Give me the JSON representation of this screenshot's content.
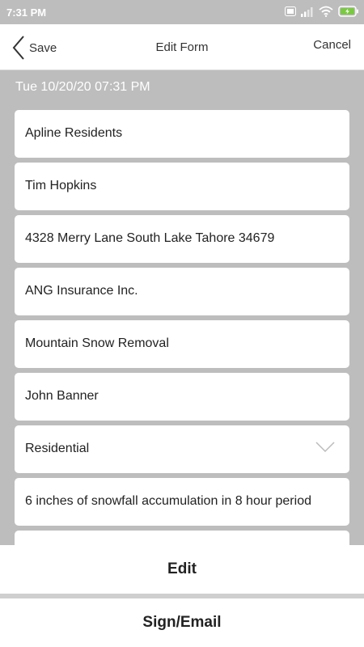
{
  "status_bar": {
    "time": "7:31 PM",
    "icons": [
      "volte-icon",
      "signal-icon",
      "wifi-icon",
      "battery-charging-icon"
    ]
  },
  "header": {
    "back_label": "Save",
    "title": "Edit Form",
    "cancel_label": "Cancel"
  },
  "form": {
    "date": "Tue 10/20/20 07:31 PM",
    "fields": [
      {
        "value": "Apline Residents"
      },
      {
        "value": "Tim Hopkins"
      },
      {
        "value": "4328 Merry Lane South Lake Tahore 34679"
      },
      {
        "value": "ANG Insurance Inc."
      },
      {
        "value": "Mountain Snow Removal"
      },
      {
        "value": "John Banner"
      },
      {
        "value": "Residential",
        "type": "select"
      },
      {
        "value": "6 inches of snowfall accumulation in 8 hour period"
      },
      {
        "value": ""
      }
    ]
  },
  "actions": {
    "edit_label": "Edit",
    "sign_label": "Sign/Email"
  },
  "colors": {
    "status_bar": "#bdbdbd",
    "form_background": "#bdbdbd",
    "card": "#ffffff",
    "battery_accent": "#7ac943"
  }
}
